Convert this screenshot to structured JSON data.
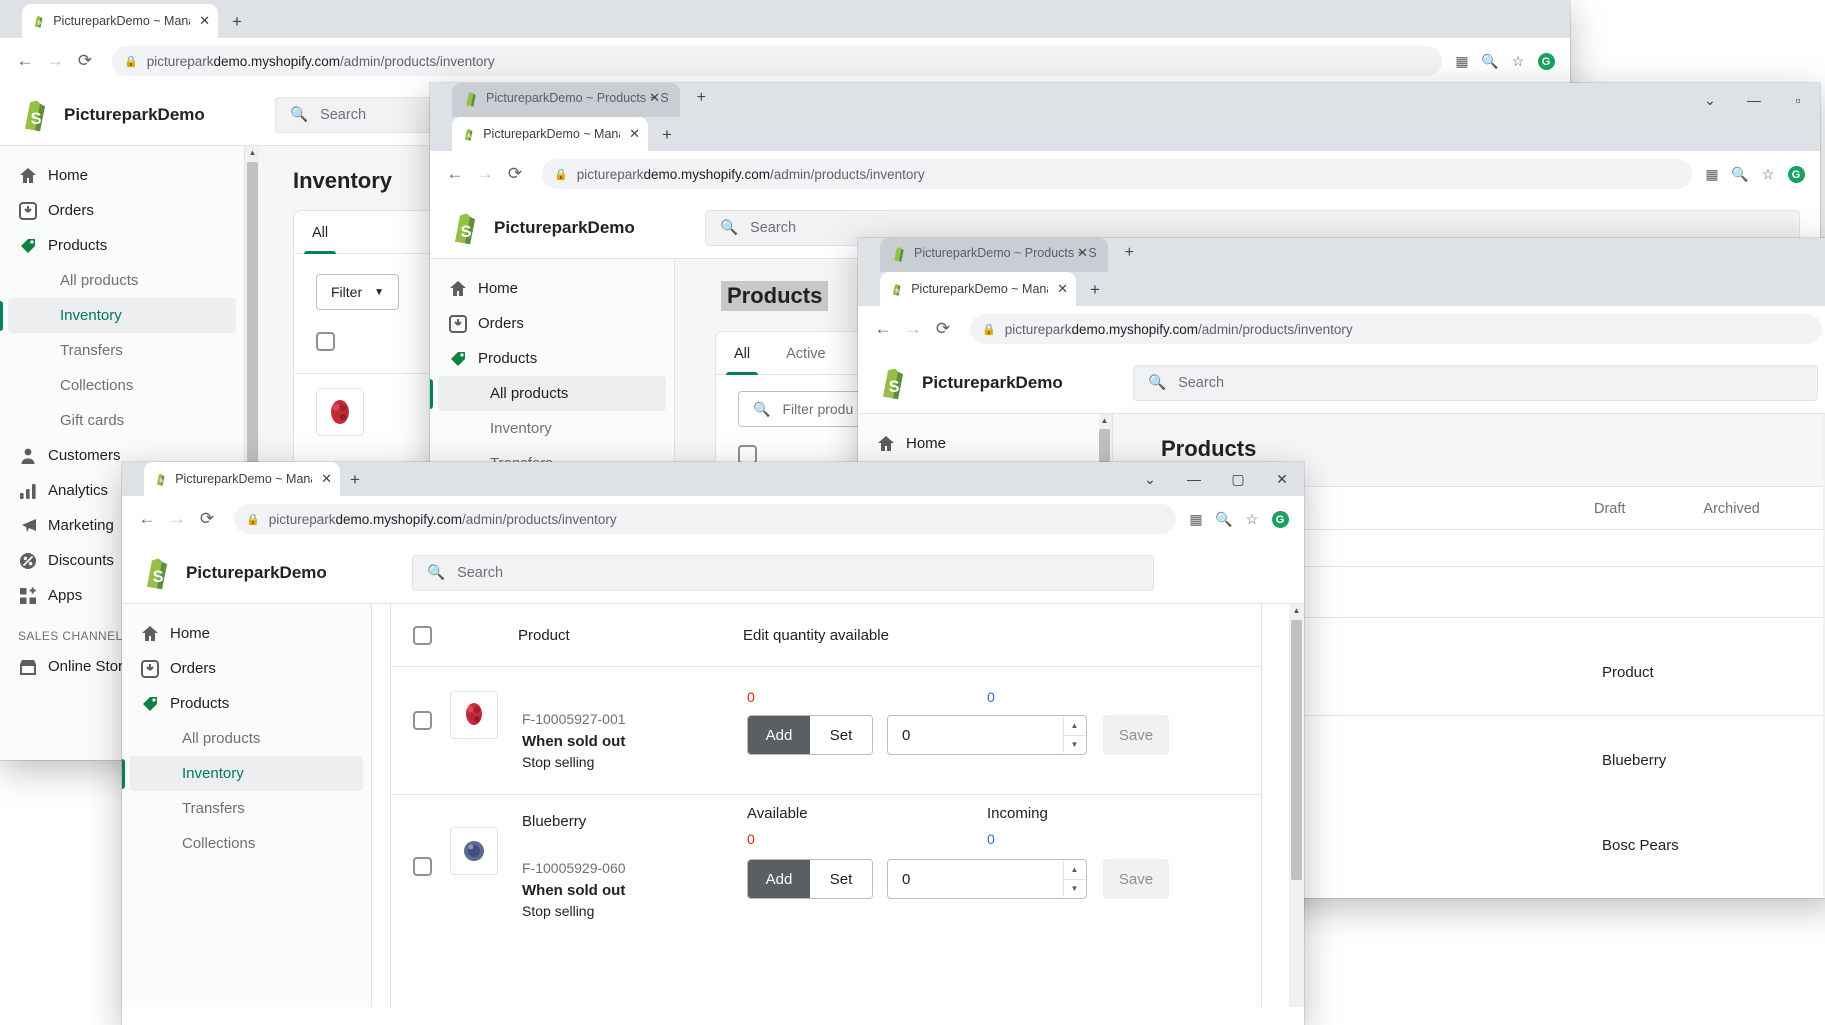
{
  "brand": {
    "name": "PictureparkDemo",
    "logo_icon": "shopify-bag-icon"
  },
  "browser": {
    "tab_title_inventory": "PictureparkDemo ~ Manage Inve",
    "tab_title_products": "PictureparkDemo ~ Products ~ S",
    "url": "picturepark demo.myshopify.com/admin/products/inventory",
    "url_host": "picturepark demo.myshopify.com",
    "url_path": "/admin/products/inventory",
    "lock_icon": "lock-icon",
    "back_icon": "arrow-left-icon",
    "forward_icon": "arrow-right-icon",
    "reload_icon": "reload-icon",
    "new_tab_icon": "plus-icon",
    "close_tab_icon": "close-icon",
    "toolbar_icons": [
      "qr-code-icon",
      "zoom-icon",
      "star-icon",
      "grammarly-icon"
    ],
    "grammarly_letter": "G",
    "window_controls": {
      "chevron": "chevron-down-icon",
      "minimize": "minimize-icon",
      "maximize": "maximize-icon",
      "close": "close-icon"
    }
  },
  "search": {
    "placeholder": "Search",
    "icon": "search-icon"
  },
  "sidebar": {
    "items": [
      {
        "label": "Home",
        "icon": "home-icon"
      },
      {
        "label": "Orders",
        "icon": "orders-inbox-icon"
      },
      {
        "label": "Products",
        "icon": "products-tag-icon"
      },
      {
        "label": "Customers",
        "icon": "customer-person-icon"
      },
      {
        "label": "Analytics",
        "icon": "analytics-bars-icon"
      },
      {
        "label": "Marketing",
        "icon": "marketing-megaphone-icon"
      },
      {
        "label": "Discounts",
        "icon": "discount-percent-icon"
      },
      {
        "label": "Apps",
        "icon": "apps-grid-plus-icon"
      }
    ],
    "product_subitems": [
      {
        "label": "All products",
        "active": false
      },
      {
        "label": "Inventory",
        "active": true
      },
      {
        "label": "Transfers",
        "active": false
      },
      {
        "label": "Collections",
        "active": false
      },
      {
        "label": "Gift cards",
        "active": false
      }
    ],
    "section_header": "SALES CHANNELS",
    "sales_channels": [
      {
        "label": "Online Store",
        "icon": "online-store-icon"
      }
    ]
  },
  "inventory_page": {
    "title": "Inventory",
    "tabs": [
      "All"
    ],
    "filter_label": "Filter",
    "filter_caret": "chevron-down-icon",
    "columns": {
      "product": "Product",
      "edit_qty": "Edit quantity available",
      "available": "Available",
      "incoming": "Incoming"
    },
    "segmented": {
      "add": "Add",
      "set": "Set"
    },
    "save_label": "Save",
    "qty_value": "0",
    "rows": [
      {
        "title": "",
        "sku": "F-10005927-001",
        "policy_label": "When sold out",
        "policy_value": "Stop selling",
        "available": "0",
        "incoming": "0",
        "thumb": "raspberry-thumbnail"
      },
      {
        "title": "Blueberry",
        "sku": "F-10005929-060",
        "policy_label": "When sold out",
        "policy_value": "Stop selling",
        "available": "0",
        "incoming": "0",
        "thumb": "blueberry-thumbnail"
      }
    ]
  },
  "products_page": {
    "title": "Products",
    "tabs": [
      "All",
      "Active",
      "Draft",
      "Archived"
    ],
    "filter_placeholder": "Filter produ",
    "column_product": "Product",
    "rows": [
      {
        "title": "Blueberry"
      },
      {
        "title": "Bosc Pears"
      }
    ]
  }
}
